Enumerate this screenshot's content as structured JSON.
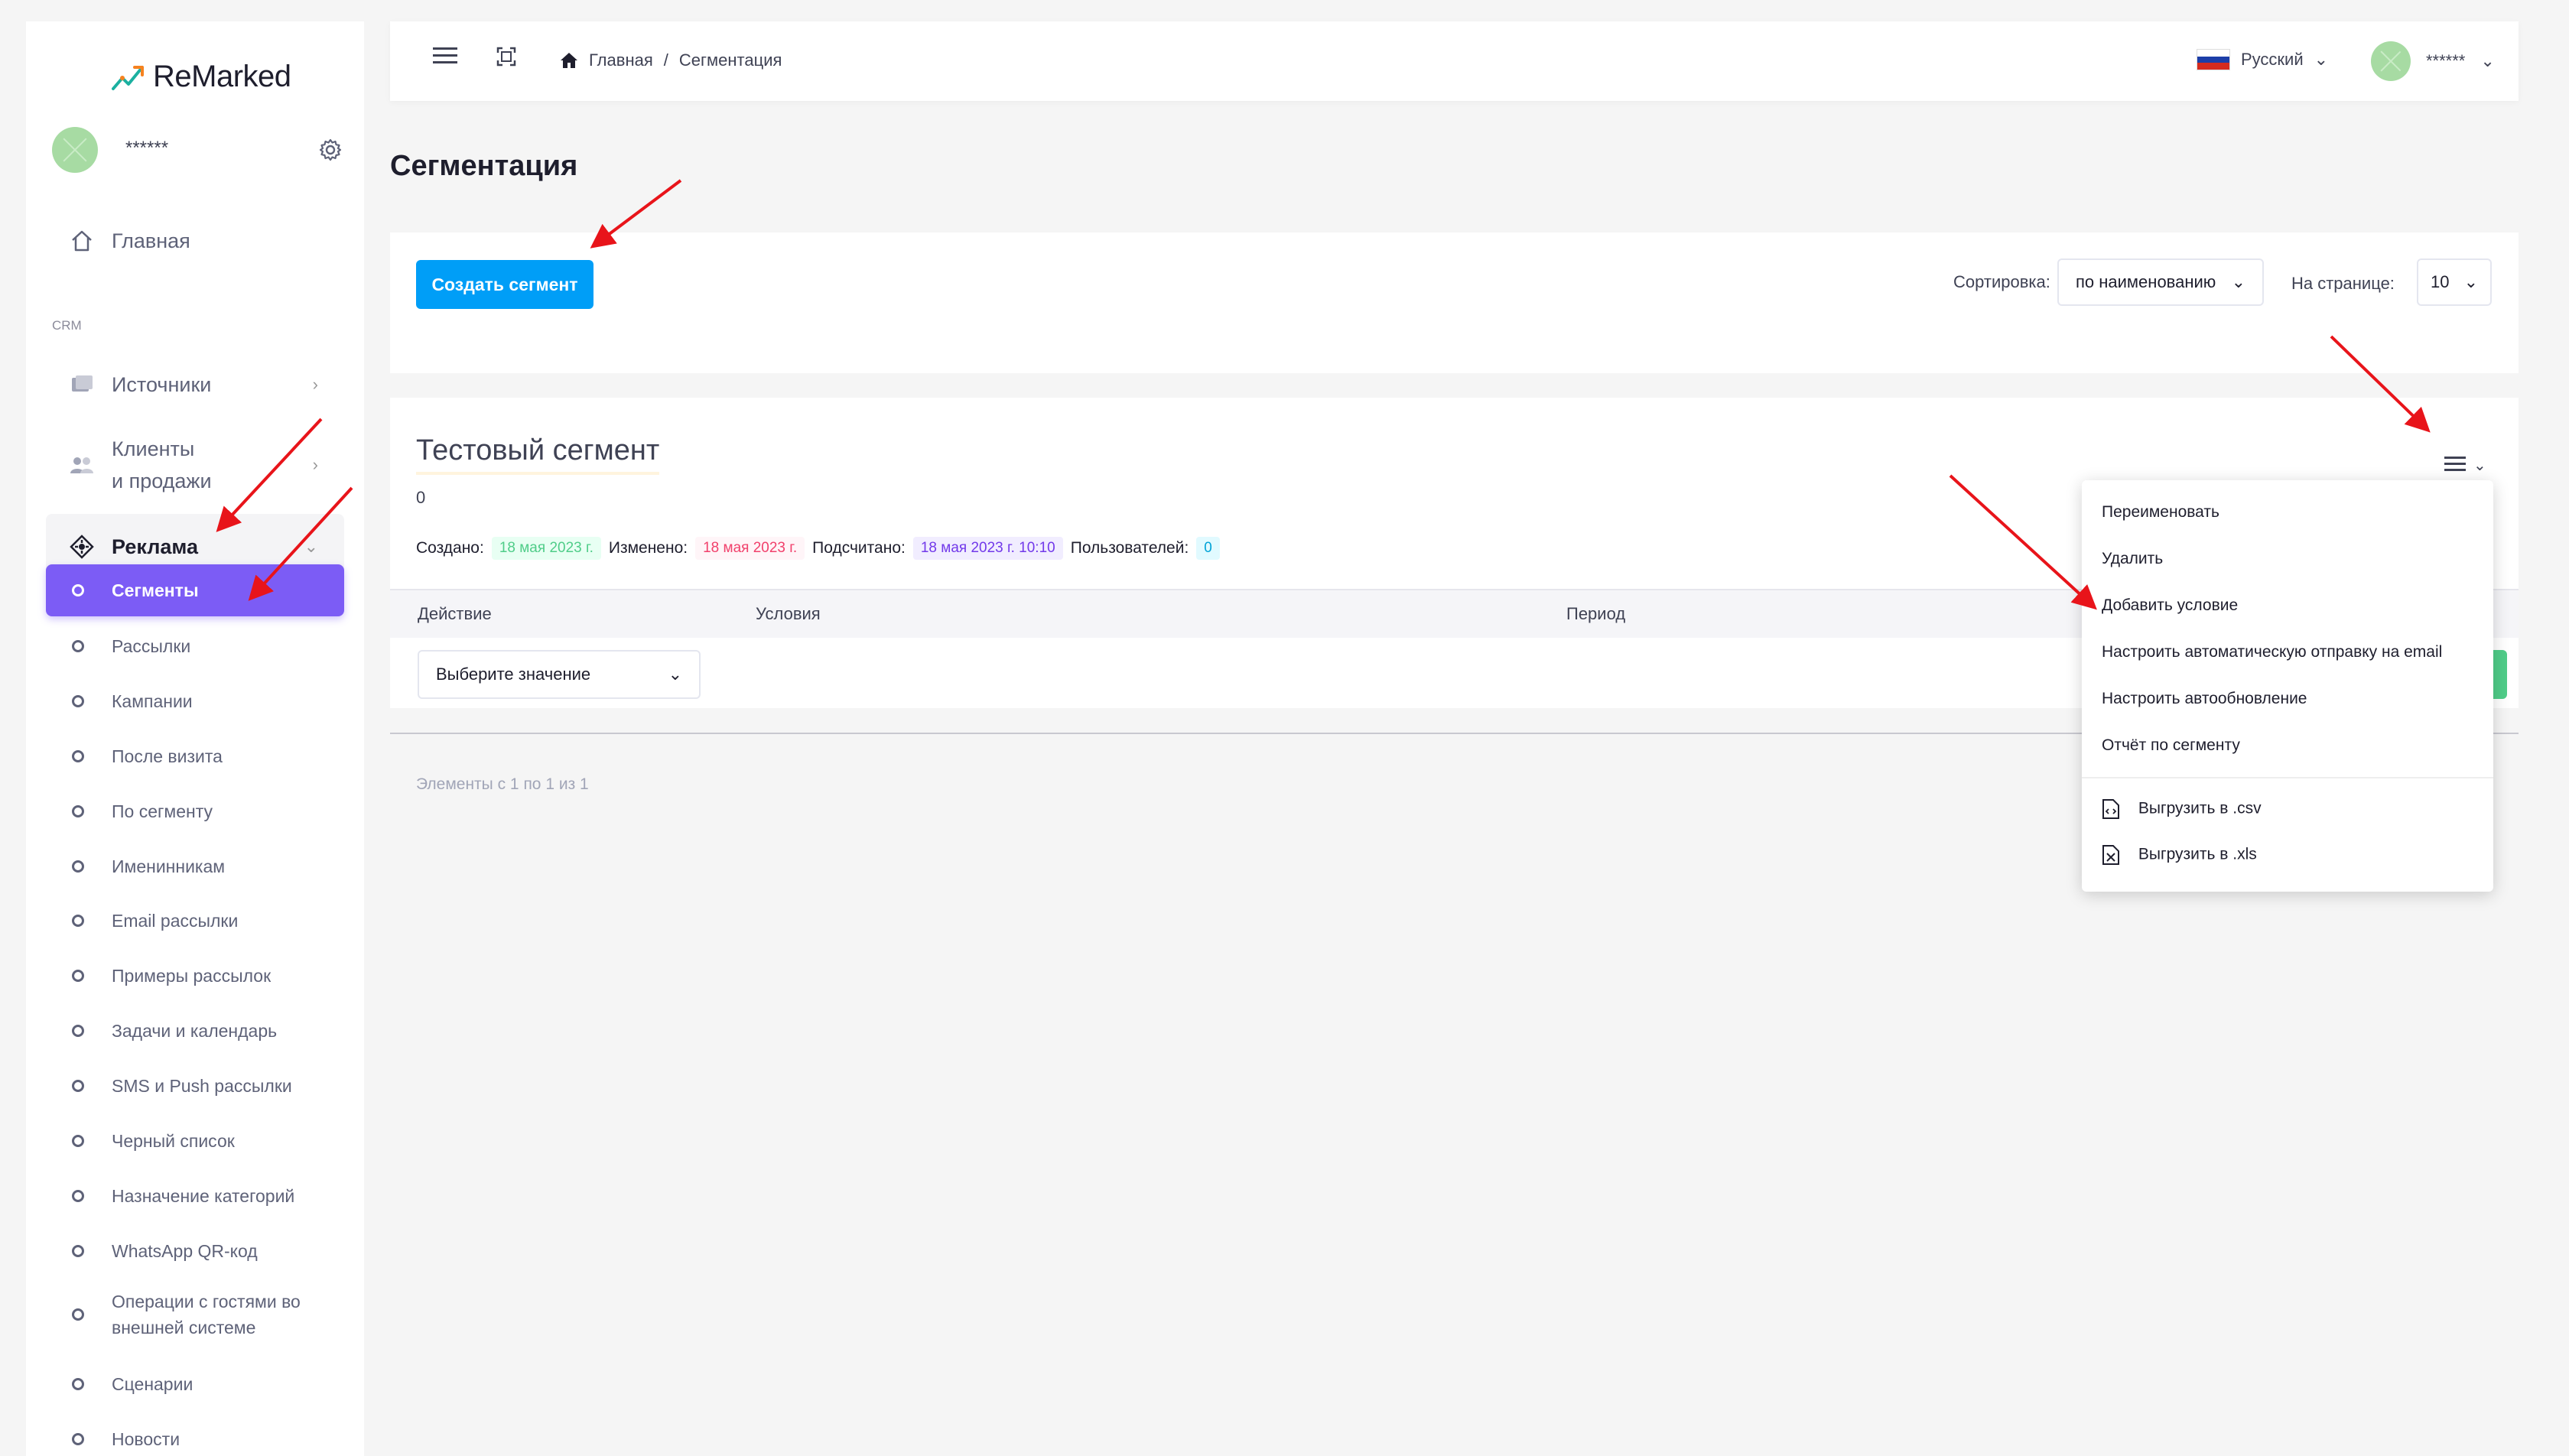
{
  "app": {
    "logo_text": "ReMarked"
  },
  "sidebar": {
    "user_name": "******",
    "home_label": "Главная",
    "section_label": "CRM",
    "items": [
      {
        "label": "Источники",
        "icon": "sources-icon"
      },
      {
        "label": "Клиенты\nи продажи",
        "label_line1": "Клиенты",
        "label_line2": "и продажи",
        "icon": "users-icon"
      },
      {
        "label": "Реклама",
        "icon": "target-icon"
      }
    ],
    "sub_items": [
      "Сегменты",
      "Рассылки",
      "Кампании",
      "После визита",
      "По сегменту",
      "Именинникам",
      "Email рассылки",
      "Примеры рассылок",
      "Задачи и календарь",
      "SMS и Push рассылки",
      "Черный список",
      "Назначение категорий",
      "WhatsApp QR-код",
      "Операции с гостями во внешней системе",
      "Сценарии",
      "Новости"
    ],
    "sub_items_wrapped": {
      "line1": "Операции с гостями во",
      "line2": "внешней системе"
    }
  },
  "header": {
    "breadcrumb_home": "Главная",
    "breadcrumb_sep": "/",
    "breadcrumb_current": "Сегментация",
    "language": "Русский",
    "user_name": "******"
  },
  "page": {
    "title": "Сегментация"
  },
  "toolbar": {
    "create_button": "Создать сегмент",
    "sort_label": "Сортировка:",
    "sort_value": "по наименованию",
    "per_page_label": "На странице:",
    "per_page_value": "10"
  },
  "segment": {
    "title": "Тестовый сегмент",
    "count": "0",
    "created_label": "Создано:",
    "created_value": "18 мая 2023 г.",
    "changed_label": "Изменено:",
    "changed_value": "18 мая 2023 г.",
    "counted_label": "Подсчитано:",
    "counted_value": "18 мая 2023 г. 10:10",
    "users_label": "Пользователей:",
    "users_value": "0",
    "columns": [
      "Действие",
      "Условия",
      "Период"
    ],
    "action_placeholder": "Выберите значение"
  },
  "pagination": {
    "text": "Элементы с 1 по 1 из 1"
  },
  "dropdown_menu": {
    "items": [
      "Переименовать",
      "Удалить",
      "Добавить условие",
      "Настроить автоматическую отправку на email",
      "Настроить автообновление",
      "Отчёт по сегменту"
    ],
    "export_csv": "Выгрузить в .csv",
    "export_xls": "Выгрузить в .xls"
  },
  "colors": {
    "primary": "#009ef7",
    "active_menu": "#7c5cf5",
    "annotation_arrow": "#e8141a",
    "success": "#50cd89"
  }
}
